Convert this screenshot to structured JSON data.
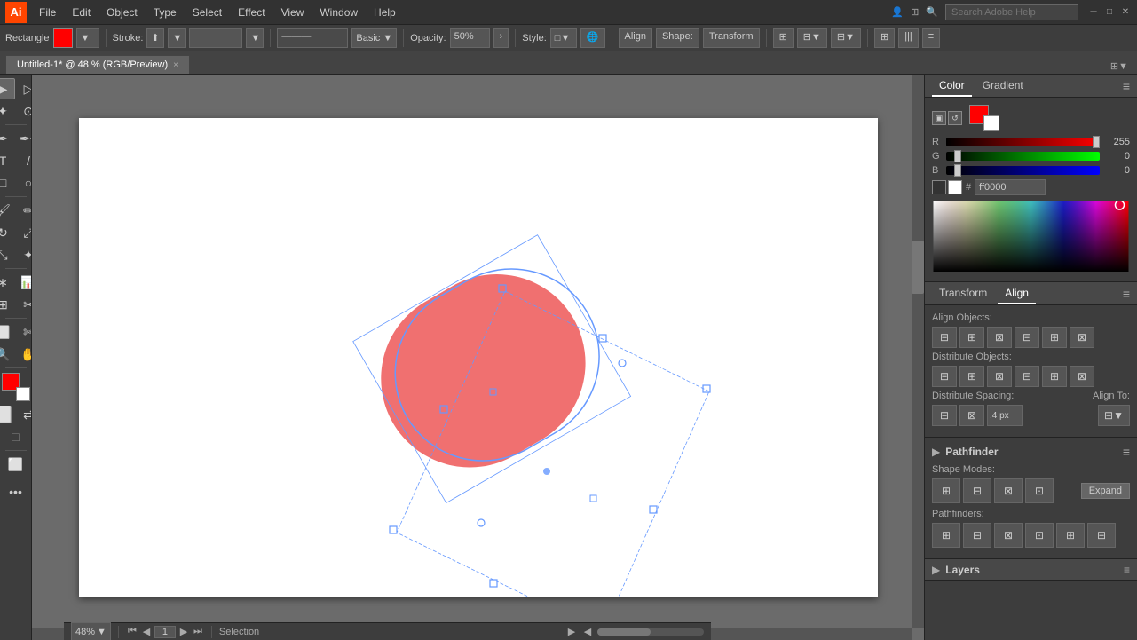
{
  "app": {
    "logo": "Ai",
    "title": "Adobe Illustrator"
  },
  "menubar": {
    "items": [
      "File",
      "Edit",
      "Object",
      "Type",
      "Select",
      "Effect",
      "View",
      "Window",
      "Help"
    ],
    "search_placeholder": "Search Adobe Help",
    "search_value": "Search Adobe Help"
  },
  "toolbar": {
    "shape_label": "Rectangle",
    "fill_color": "#ff0000",
    "stroke_label": "Stroke:",
    "stroke_value": "",
    "opacity_label": "Opacity:",
    "opacity_value": "50%",
    "style_label": "Style:",
    "basic_label": "Basic",
    "align_label": "Align",
    "shape_mode_label": "Shape:",
    "transform_label": "Transform"
  },
  "tab": {
    "title": "Untitled-1* @ 48 % (RGB/Preview)",
    "close": "×"
  },
  "canvas": {
    "zoom": "48%",
    "page": "1",
    "tool_status": "Selection"
  },
  "color_panel": {
    "tab_color": "Color",
    "tab_gradient": "Gradient",
    "r_label": "R",
    "r_value": "255",
    "g_label": "G",
    "g_value": "0",
    "b_label": "B",
    "b_value": "0",
    "hex_label": "#",
    "hex_value": "ff0000"
  },
  "align_panel": {
    "title": "Align",
    "align_objects_label": "Align Objects:",
    "distribute_objects_label": "Distribute Objects:",
    "distribute_spacing_label": "Distribute Spacing:",
    "align_to_label": "Align To:"
  },
  "pathfinder_panel": {
    "title": "Pathfinder",
    "shape_modes_label": "Shape Modes:",
    "pathfinders_label": "Pathfinders:",
    "expand_label": "Expand"
  },
  "layers_panel": {
    "title": "Layers"
  },
  "tools": [
    "selection",
    "direct-selection",
    "magic-wand",
    "lasso",
    "pen",
    "add-anchor",
    "type",
    "line",
    "rectangle",
    "ellipse",
    "paintbrush",
    "pencil",
    "rotate",
    "scale",
    "free-transform",
    "puppet",
    "symbol-sprayer",
    "graph",
    "artboard",
    "slice",
    "eraser",
    "scissors",
    "zoom",
    "hand",
    "color-fg",
    "color-bg",
    "none-icon",
    "color-mode"
  ],
  "colors": {
    "accent": "#ff0000",
    "ui_bg": "#3d3d3d",
    "panel_bg": "#484848",
    "canvas_bg": "#6b6b6b",
    "white": "#ffffff"
  }
}
